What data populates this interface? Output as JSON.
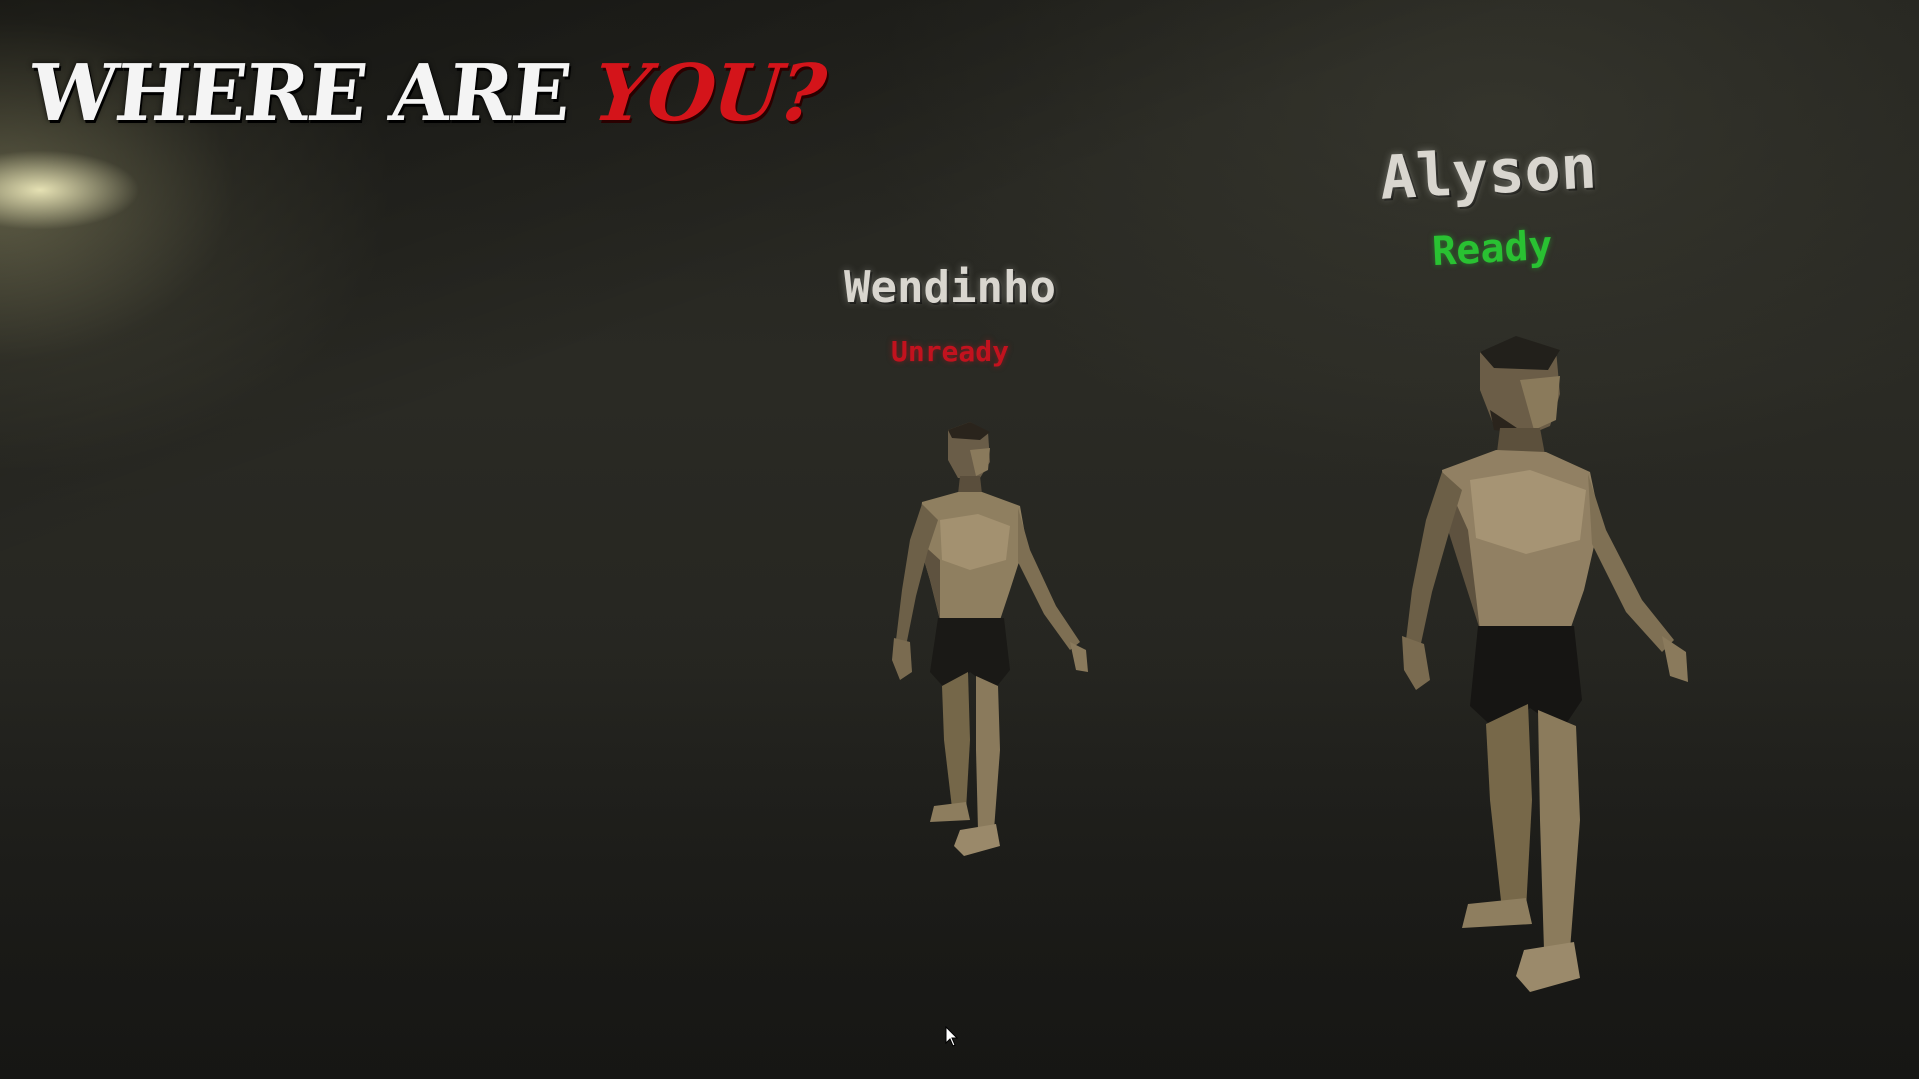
{
  "game": {
    "logo": {
      "part1": "WHERE ARE",
      "part2": "YOU",
      "part3": "?"
    }
  },
  "players": [
    {
      "name": "Wendinho",
      "status": "Unready",
      "status_color": "#c2121e"
    },
    {
      "name": "Alyson",
      "status": "Ready",
      "status_color": "#29c132"
    }
  ],
  "icons": {
    "cursor": "mouse-pointer-icon"
  }
}
